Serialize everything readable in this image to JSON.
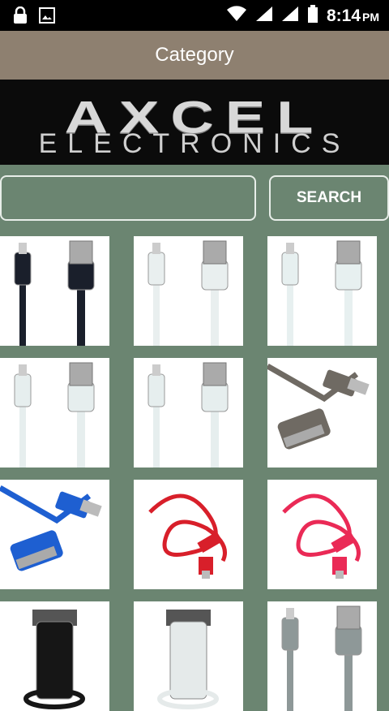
{
  "status_bar": {
    "time": "8:14",
    "ampm": "PM",
    "icons": [
      "lock-icon",
      "image-icon",
      "wifi-icon",
      "signal-icon",
      "signal-icon",
      "battery-icon"
    ]
  },
  "title_bar": {
    "title": "Category"
  },
  "banner": {
    "brand": "AXCEL",
    "subtitle": "ELECTRONICS"
  },
  "search": {
    "placeholder": "",
    "button_label": "SEARCH"
  },
  "products": [
    {
      "color": "#1a1f2b",
      "variant": "black-flat-lightning"
    },
    {
      "color": "#e9efef",
      "variant": "white-flat-lightning"
    },
    {
      "color": "#e7f0f0",
      "variant": "white-lightning"
    },
    {
      "color": "#e6eeee",
      "variant": "white-lightning"
    },
    {
      "color": "#e6eeee",
      "variant": "white-lightning"
    },
    {
      "color": "#6f6a63",
      "variant": "gray-30pin"
    },
    {
      "color": "#1e5fd1",
      "variant": "blue-30pin"
    },
    {
      "color": "#d81f2a",
      "variant": "red-coiled"
    },
    {
      "color": "#ea2a56",
      "variant": "pink-coiled"
    },
    {
      "color": "#161616",
      "variant": "black-flat-connector"
    },
    {
      "color": "#e5eaea",
      "variant": "white-flat-connector"
    },
    {
      "color": "#8e9898",
      "variant": "gray-braided-lightning"
    }
  ]
}
